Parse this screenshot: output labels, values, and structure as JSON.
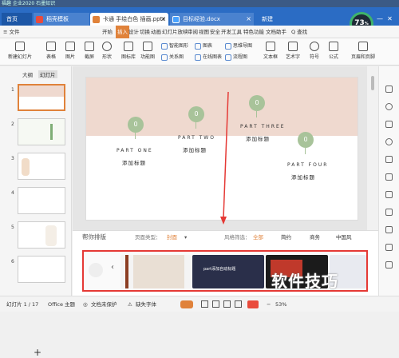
{
  "titlebar": {
    "text": "福趣 企业2020 石墨知识"
  },
  "tabs": [
    {
      "label": "首页"
    },
    {
      "label": "稻壳模板"
    },
    {
      "label": "卡通 手绘白色 插画.pptx"
    },
    {
      "label": "目标经验.docx"
    },
    {
      "label": "新建"
    }
  ],
  "gauge": {
    "value": "73",
    "unit": "%"
  },
  "window_controls": {
    "min": "—",
    "close": "✕"
  },
  "menu": {
    "file": "≡ 文件",
    "items": [
      "开始",
      "插入",
      "设计",
      "切换",
      "动画",
      "幻灯片放映",
      "审阅",
      "视图",
      "安全",
      "开发工具",
      "特色功能",
      "文档助手"
    ],
    "active": "插入",
    "search": "Q 查找"
  },
  "ribbon": {
    "big_buttons": [
      "新建幻灯片",
      "表格",
      "图片",
      "截屏",
      "形状",
      "图标库",
      "功能图",
      "文本框",
      "艺术字",
      "符号",
      "公式",
      "页眉和页脚"
    ],
    "small_buttons": [
      "智能图形",
      "图表",
      "思维导图",
      "关系图",
      "在线图表",
      "流程图"
    ]
  },
  "left_panel": {
    "tabs": [
      "大纲",
      "幻灯片"
    ],
    "slide_numbers": [
      "1",
      "2",
      "3",
      "4",
      "5",
      "6"
    ]
  },
  "slide": {
    "sections": [
      {
        "num": "0",
        "title": "PART ONE",
        "subtitle": "添加标题"
      },
      {
        "num": "0",
        "title": "PART TWO",
        "subtitle": "添加标题"
      },
      {
        "num": "0",
        "title": "PART THREE",
        "subtitle": "添加标题"
      },
      {
        "num": "0",
        "title": "PART FOUR",
        "subtitle": "添加标题"
      }
    ]
  },
  "design_panel": {
    "title": "帮你排版",
    "type_label": "页面类型：",
    "type_value": "封面",
    "style_label": "风格筛选：",
    "styles": [
      "全部",
      "简约",
      "商务",
      "中国风"
    ],
    "template_text": "part添加自动标题",
    "nav_prev": "‹"
  },
  "watermark": "软件技巧",
  "statusbar": {
    "slide_info": "幻灯片 1 / 17",
    "theme": "Office 主题",
    "doc_protect": "文档未保护",
    "missing_font": "缺失字体",
    "zoom": "53%"
  },
  "colors": {
    "accent": "#e0823a",
    "tabbar": "#2b6cc4",
    "pin": "#a8c39a",
    "slide_top": "#efd9cf",
    "highlight": "#e53935"
  }
}
